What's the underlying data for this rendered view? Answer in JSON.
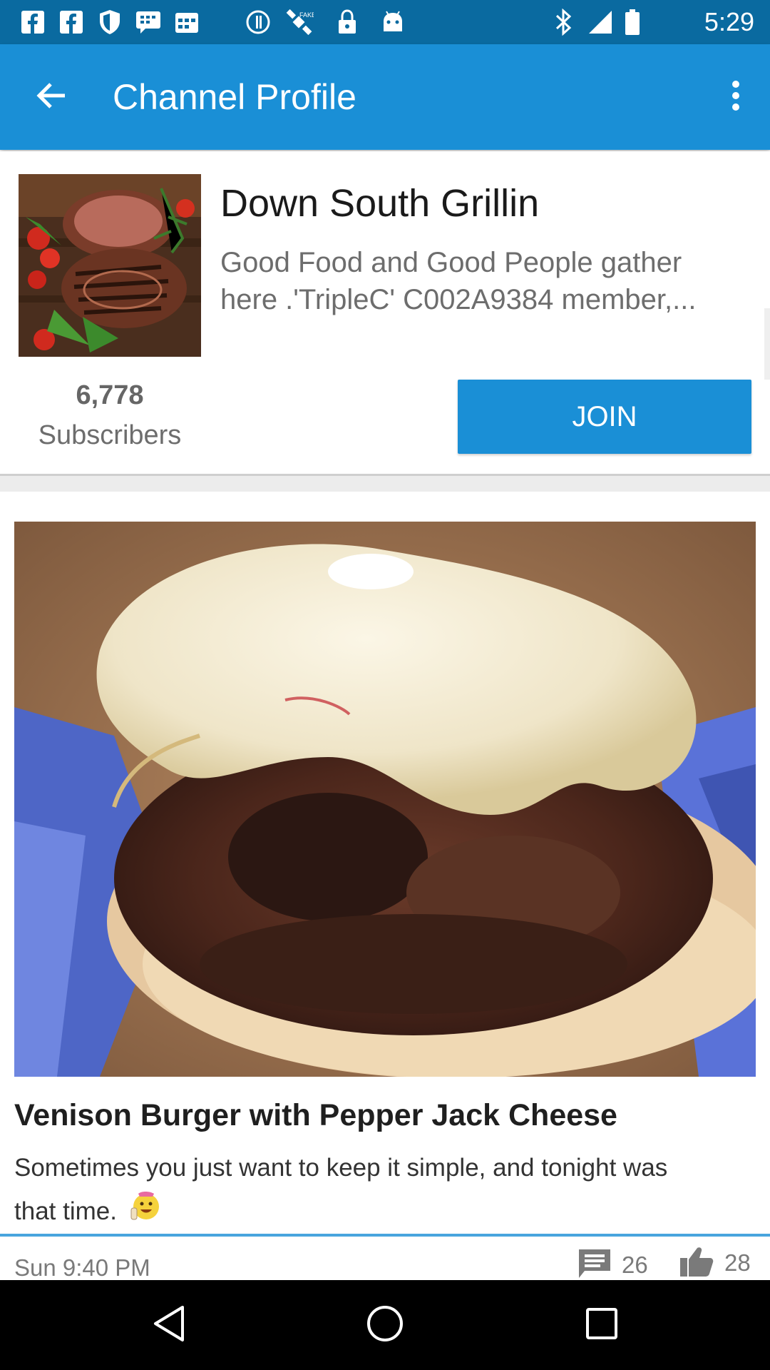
{
  "status_bar": {
    "time": "5:29",
    "icons": [
      "facebook-icon",
      "facebook-icon",
      "shield-icon",
      "chat-icon",
      "calendar-icon",
      "info-icon",
      "satellite-icon",
      "lock-icon",
      "android-icon",
      "bluetooth-icon",
      "signal-icon",
      "battery-icon"
    ]
  },
  "app_bar": {
    "title": "Channel Profile",
    "back_icon": "arrow-back-icon",
    "menu_icon": "more-vert-icon"
  },
  "channel": {
    "name": "Down South Grillin",
    "description_line1": "Good Food and Good People gather",
    "description_line2": "here .'TripleC'  C002A9384 member,...",
    "subscriber_count": "6,778",
    "subscriber_label": "Subscribers",
    "join_label": "JOIN",
    "accent_color": "#1a8fd6"
  },
  "post": {
    "title": "Venison Burger with Pepper Jack Cheese",
    "body_line1": "Sometimes you just want to keep it simple, and tonight was",
    "body_line2": "that time.",
    "timestamp": "Sun 9:40 PM",
    "comment_count": "26",
    "like_count": "28"
  },
  "nav_bar": {
    "buttons": [
      "back-triangle-icon",
      "home-circle-icon",
      "recents-square-icon"
    ]
  }
}
